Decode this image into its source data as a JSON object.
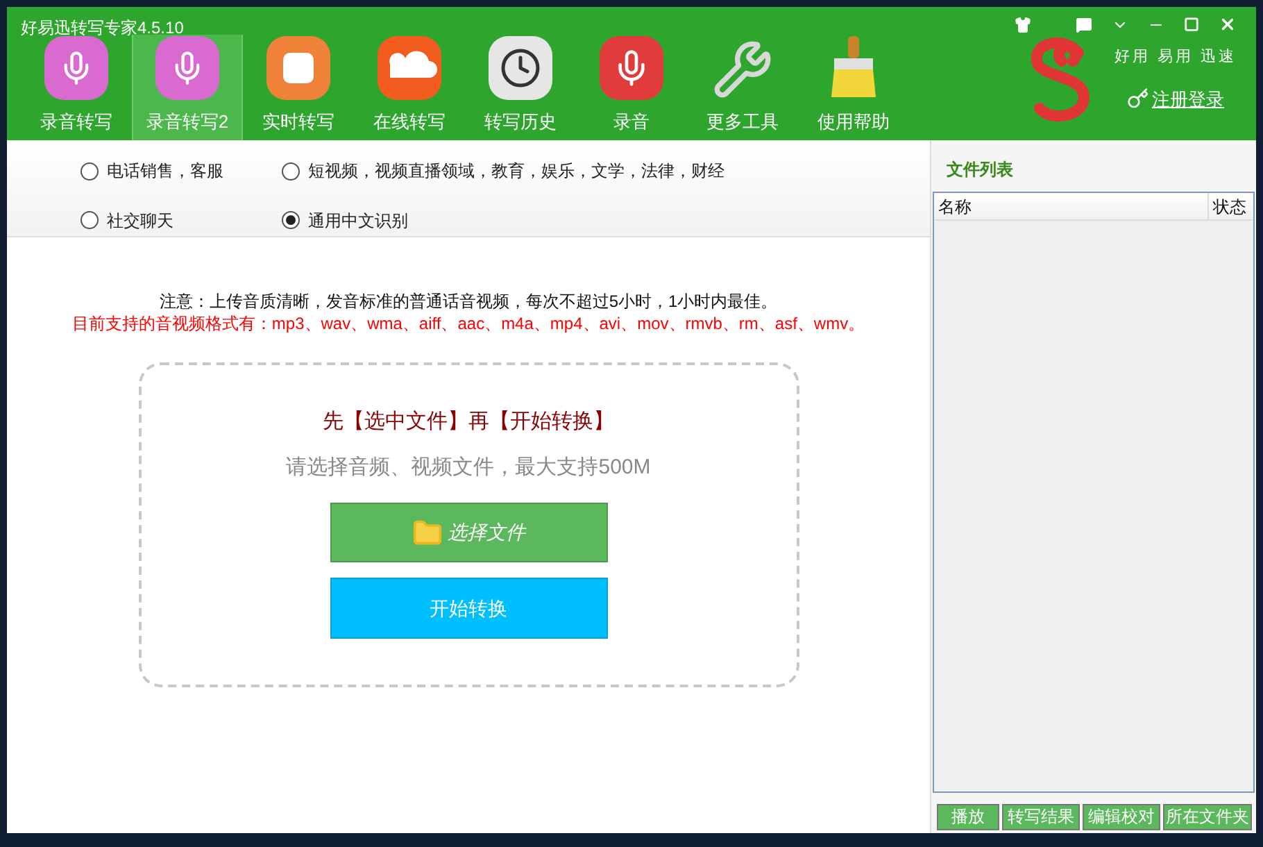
{
  "window": {
    "title": "好易迅转写专家4.5.10"
  },
  "toolbar": [
    {
      "label": "录音转写",
      "selected": false
    },
    {
      "label": "录音转写2",
      "selected": true
    },
    {
      "label": "实时转写",
      "selected": false
    },
    {
      "label": "在线转写",
      "selected": false
    },
    {
      "label": "转写历史",
      "selected": false
    },
    {
      "label": "录音",
      "selected": false
    },
    {
      "label": "更多工具",
      "selected": false
    },
    {
      "label": "使用帮助",
      "selected": false
    }
  ],
  "brand": {
    "tagline": "好用 易用 迅速",
    "login_link": "注册登录"
  },
  "scenarios": [
    {
      "label": "电话销售，客服",
      "selected": false
    },
    {
      "label": "短视频，视频直播领域，教育，娱乐，文学，法律，财经",
      "selected": false
    },
    {
      "label": "社交聊天",
      "selected": false
    },
    {
      "label": "通用中文识别",
      "selected": true
    }
  ],
  "notice": "注意：上传音质清晰，发音标准的普通话音视频，每次不超过5小时，1小时内最佳。",
  "formats": "目前支持的音视频格式有：mp3、wav、wma、aiff、aac、m4a、mp4、avi、mov、rmvb、rm、asf、wmv。",
  "upload": {
    "prompt": "先【选中文件】再【开始转换】",
    "hint": "请选择音频、视频文件，最大支持500M",
    "select_button": "选择文件",
    "start_button": "开始转换"
  },
  "file_list": {
    "title": "文件列表",
    "columns": [
      "名称",
      "状态"
    ],
    "buttons": [
      "播放",
      "转写结果",
      "编辑校对",
      "所在文件夹"
    ]
  }
}
